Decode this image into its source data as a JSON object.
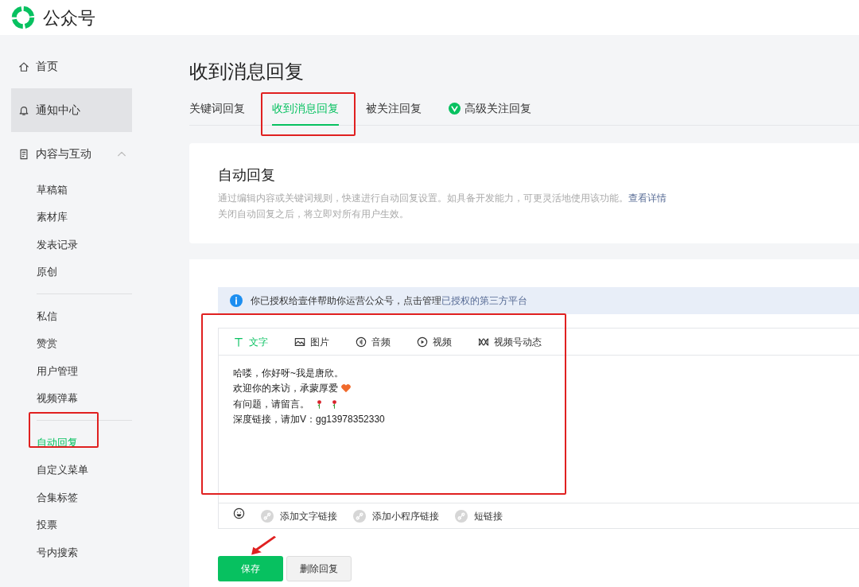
{
  "header": {
    "title": "公众号"
  },
  "sidebar": {
    "items": [
      {
        "label": "首页",
        "highlighted": false
      },
      {
        "label": "通知中心",
        "highlighted": true
      },
      {
        "label": "内容与互动",
        "highlighted": false,
        "expanded": true,
        "children": [
          {
            "label": "草稿箱",
            "selected": false
          },
          {
            "label": "素材库",
            "selected": false
          },
          {
            "label": "发表记录",
            "selected": false
          },
          {
            "label": "原创",
            "selected": false
          },
          {
            "kind": "divider"
          },
          {
            "label": "私信",
            "selected": false
          },
          {
            "label": "赞赏",
            "selected": false
          },
          {
            "label": "用户管理",
            "selected": false
          },
          {
            "label": "视频弹幕",
            "selected": false
          },
          {
            "kind": "divider"
          },
          {
            "label": "自动回复",
            "selected": true
          },
          {
            "label": "自定义菜单",
            "selected": false
          },
          {
            "label": "合集标签",
            "selected": false
          },
          {
            "label": "投票",
            "selected": false
          },
          {
            "label": "号内搜索",
            "selected": false
          }
        ]
      }
    ]
  },
  "page": {
    "title": "收到消息回复",
    "tabs": [
      {
        "label": "关键词回复",
        "selected": false,
        "badge": false
      },
      {
        "label": "收到消息回复",
        "selected": true,
        "badge": false
      },
      {
        "label": "被关注回复",
        "selected": false,
        "badge": false
      },
      {
        "label": "高级关注回复",
        "selected": false,
        "badge": true
      }
    ],
    "intro": {
      "title": "自动回复",
      "description": "通过编辑内容或关键词规则，快速进行自动回复设置。如具备开发能力，可更灵活地使用该功能。",
      "link": "查看详情",
      "note": "关闭自动回复之后，将立即对所有用户生效。"
    },
    "notice": {
      "text": "你已授权给壹伴帮助你运营公众号，点击管理",
      "link": "已授权的第三方平台"
    },
    "editor": {
      "types": [
        {
          "label": "文字",
          "selected": true
        },
        {
          "label": "图片",
          "selected": false
        },
        {
          "label": "音频",
          "selected": false
        },
        {
          "label": "视频",
          "selected": false
        },
        {
          "label": "视频号动态",
          "selected": false
        }
      ],
      "lines": [
        {
          "text": "哈喽，你好呀~我是唐欣。",
          "kind": "plain"
        },
        {
          "text": "欢迎你的来访，承蒙厚爱",
          "kind": "heart"
        },
        {
          "text": "有问题，请留言。",
          "kind": "roses"
        },
        {
          "text": "深度链接，请加V：gg13978352330",
          "kind": "plain"
        }
      ],
      "tools": [
        "添加文字链接",
        "添加小程序链接",
        "短链接"
      ]
    },
    "buttons": [
      {
        "label": "保存",
        "kind": "primary"
      },
      {
        "label": "删除回复",
        "kind": "secondary"
      }
    ]
  }
}
